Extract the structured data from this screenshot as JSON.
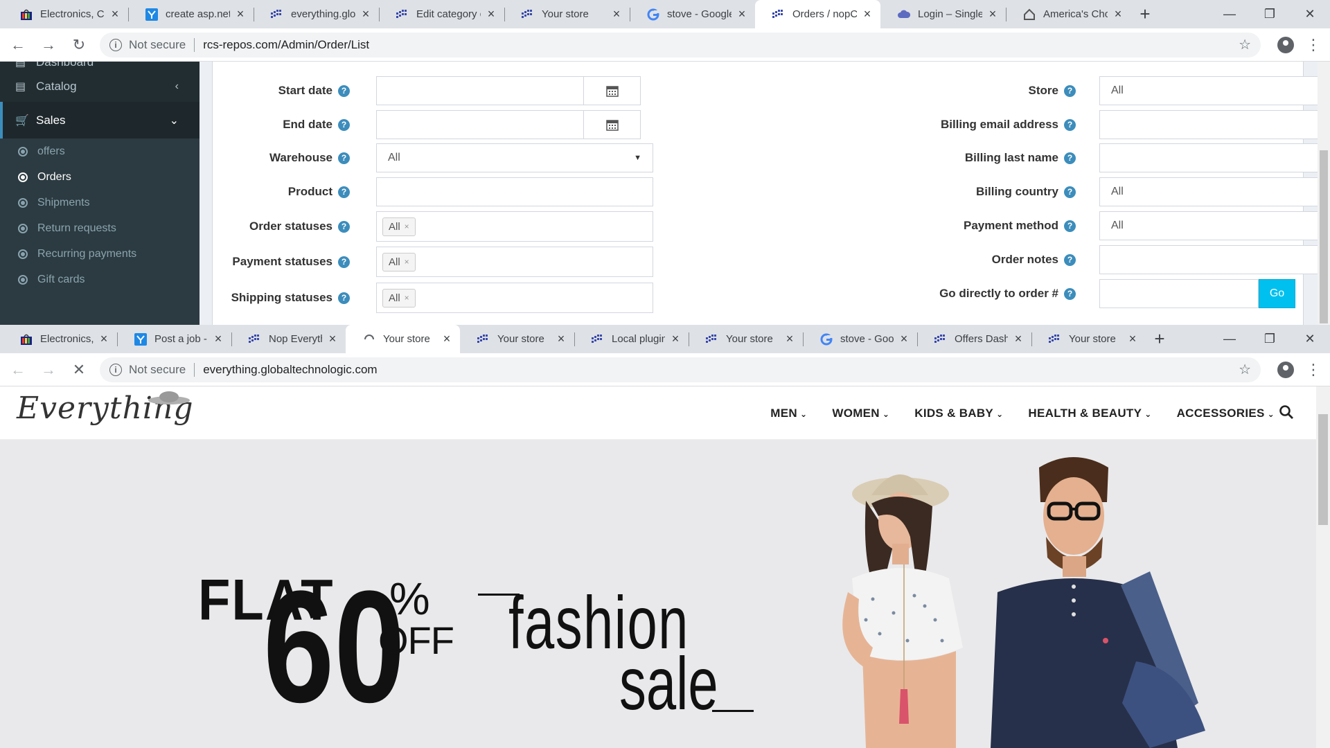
{
  "window1": {
    "tabs": [
      {
        "label": "Electronics, Car",
        "icon": "store-bag-icon"
      },
      {
        "label": "create asp.net r",
        "icon": "upwork-y-icon"
      },
      {
        "label": "everything.glob",
        "icon": "nop-grid-icon"
      },
      {
        "label": "Edit category d",
        "icon": "nop-grid-icon"
      },
      {
        "label": "Your store",
        "icon": "nop-grid-icon"
      },
      {
        "label": "stove - Google",
        "icon": "google-g-icon"
      },
      {
        "label": "Orders / nopCo",
        "icon": "nop-grid-icon",
        "active": true
      },
      {
        "label": "Login – SingleS",
        "icon": "cloud-icon"
      },
      {
        "label": "America's Choi",
        "icon": "house-icon"
      }
    ],
    "address": {
      "not_secure": "Not secure",
      "url": "rcs-repos.com/Admin/Order/List"
    },
    "sidebar": {
      "dashboard": "Dashboard",
      "catalog": "Catalog",
      "sales": "Sales",
      "sub_items": [
        "offers",
        "Orders",
        "Shipments",
        "Return requests",
        "Recurring payments",
        "Gift cards"
      ],
      "current": "Orders"
    },
    "filters_left": {
      "start_date": "Start date",
      "end_date": "End date",
      "warehouse": "Warehouse",
      "warehouse_value": "All",
      "product": "Product",
      "order_statuses": "Order statuses",
      "payment_statuses": "Payment statuses",
      "shipping_statuses": "Shipping statuses",
      "chip_all": "All",
      "chip_x": "×"
    },
    "filters_right": {
      "store": "Store",
      "store_value": "All",
      "billing_email": "Billing email address",
      "billing_last_name": "Billing last name",
      "billing_country": "Billing country",
      "billing_country_value": "All",
      "payment_method": "Payment method",
      "payment_method_value": "All",
      "order_notes": "Order notes",
      "go_directly": "Go directly to order #",
      "go_button": "Go"
    },
    "hint_glyph": "?"
  },
  "window2": {
    "tabs": [
      {
        "label": "Electronics, C",
        "icon": "store-bag-icon"
      },
      {
        "label": "Post a job - U",
        "icon": "upwork-y-icon"
      },
      {
        "label": "Nop Everyth",
        "icon": "nop-grid-icon"
      },
      {
        "label": "Your store",
        "icon": "loading-spinner-icon",
        "active": true
      },
      {
        "label": "Your store",
        "icon": "nop-grid-icon"
      },
      {
        "label": "Local plugin",
        "icon": "nop-grid-icon"
      },
      {
        "label": "Your store",
        "icon": "nop-grid-icon"
      },
      {
        "label": "stove - Goog",
        "icon": "google-g-icon"
      },
      {
        "label": "Offers Dashb",
        "icon": "nop-grid-icon"
      },
      {
        "label": "Your store",
        "icon": "nop-grid-icon"
      }
    ],
    "address": {
      "not_secure": "Not secure",
      "url": "everything.globaltechnologic.com"
    },
    "store": {
      "logo": "Everything",
      "menu": [
        "MEN",
        "WOMEN",
        "KIDS & BABY",
        "HEALTH & BEAUTY",
        "ACCESSORIES"
      ],
      "banner": {
        "flat": "FLAT",
        "number": "60",
        "pct": "%",
        "off": "OFF",
        "fashion": "fashion",
        "sale": "sale"
      }
    }
  },
  "colors": {
    "accent": "#3c8dbc",
    "go": "#00c0ef",
    "sidebar": "#222d32",
    "chrome": "#dee1e6"
  }
}
